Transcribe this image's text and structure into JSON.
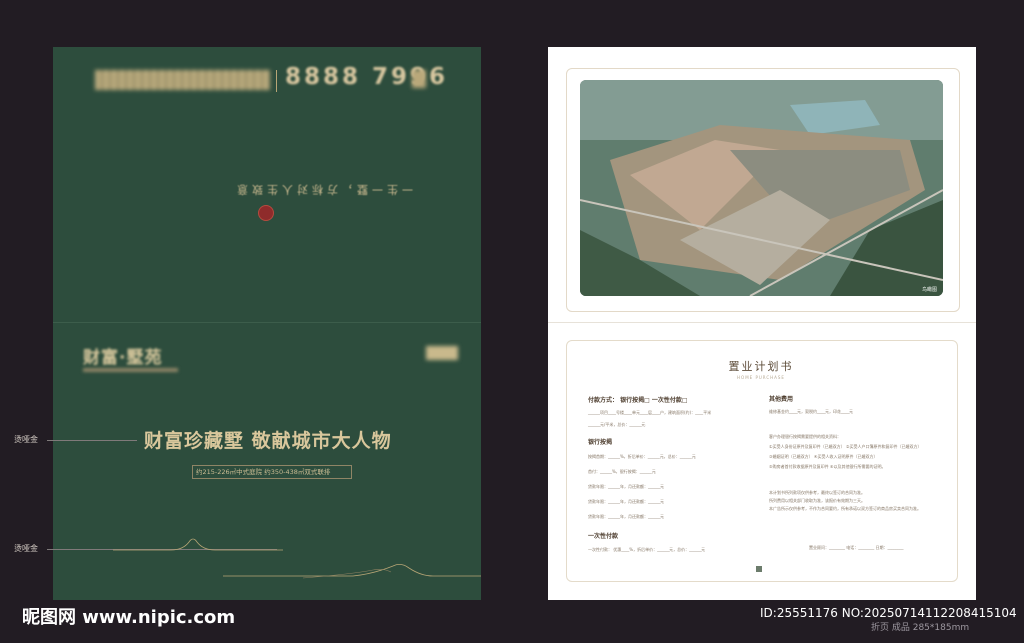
{
  "left_page": {
    "phone": "8888 7996",
    "slogan": "一生一墅，方标对人生致意",
    "logo_text": "财富·墅苑",
    "headline": "财富珍藏墅  敬献城市大人物",
    "spec": "约215-226㎡中式庭院  约350-438㎡双式联排",
    "colors": {
      "panel": "#2d4d3d",
      "gold": "#d9c79c",
      "seal": "#8f2b2b"
    }
  },
  "side_labels": [
    "烫哑金",
    "烫哑金"
  ],
  "right_page": {
    "photo_note": "鸟瞰图",
    "form_title": "置业计划书",
    "form_subtitle": "HOME PURCHASE",
    "payment_heading": "付款方式：  银行按揭□  一次性付款□",
    "payment_line": "______项目____号楼____单元____层____户，建筑面积(约)：____平米",
    "price_line": "______元/平米，总价：______元",
    "bank_heading": "银行按揭",
    "bank_lines": [
      "按揭首期：______%，折后单价：______元，总价：______元",
      "首付：______%，银行按揭：______元",
      "贷款年限：______年，月还款额：______元",
      "贷款年限：______年，月还款额：______元",
      "贷款年限：______年，月还款额：______元"
    ],
    "once_heading": "一次性付款",
    "once_line": "一次性付款：  优惠____%，折后单价：______元，总价：______元",
    "other_heading": "其他费用",
    "other_line": "维修基金约____元，契税约____元，印花____元",
    "other_notes": [
      "客户办理银行按揭需要提供的相关资料：",
      "①买受人身份证原件及复印件（已婚双方）  ②买受人户口簿原件和复印件（已婚双方）",
      "③婚姻证明（已婚双方）  ④买受人收入证明原件（已婚双方）",
      "⑤购房者首付款收据原件及复印件  ⑥以及其他银行所需要的证明。"
    ],
    "disclaimer": [
      "本计划书所列款项仅供参考，最终以签订的合同为准。",
      "所列费用以相关部门收取为准，该报价有效期为三天。",
      "本广告所示仅供参考，不作为合同要约，所有承诺以双方签订的商品房买卖合同为准。"
    ],
    "signature_line": "置业顾问：________  电话：________  日期：________"
  },
  "watermark": {
    "site": "昵图网 www.nipic.com",
    "id": "ID:25551176 NO:20250714112208415104",
    "size": "折页  成品  285*185mm"
  }
}
